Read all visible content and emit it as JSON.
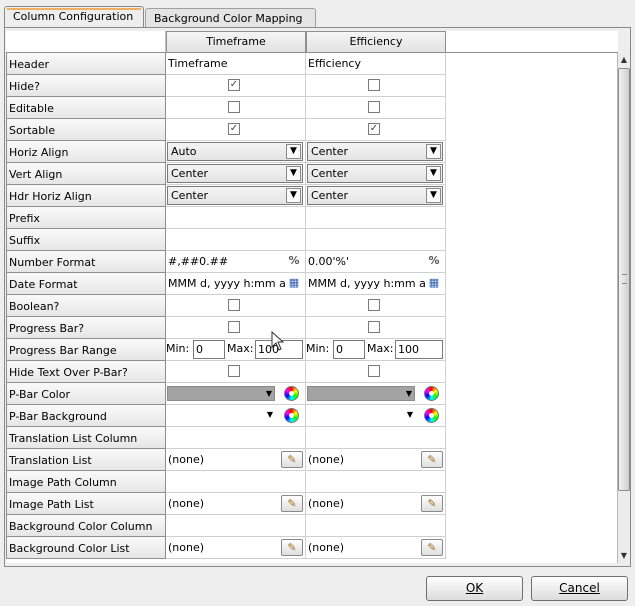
{
  "tabs": [
    {
      "label": "Column Configuration",
      "active": true
    },
    {
      "label": "Background Color Mapping",
      "active": false
    }
  ],
  "columns": [
    "Timeframe",
    "Efficiency"
  ],
  "rows": {
    "header": {
      "label": "Header",
      "values": [
        "Timeframe",
        "Efficiency"
      ]
    },
    "hide": {
      "label": "Hide?",
      "values": [
        true,
        false
      ]
    },
    "editable": {
      "label": "Editable",
      "values": [
        false,
        false
      ]
    },
    "sortable": {
      "label": "Sortable",
      "values": [
        true,
        true
      ]
    },
    "horiz_align": {
      "label": "Horiz Align",
      "values": [
        "Auto",
        "Center"
      ]
    },
    "vert_align": {
      "label": "Vert Align",
      "values": [
        "Center",
        "Center"
      ]
    },
    "hdr_horiz_align": {
      "label": "Hdr Horiz Align",
      "values": [
        "Center",
        "Center"
      ]
    },
    "prefix": {
      "label": "Prefix",
      "values": [
        "",
        ""
      ]
    },
    "suffix": {
      "label": "Suffix",
      "values": [
        "",
        ""
      ]
    },
    "number_format": {
      "label": "Number Format",
      "values": [
        "#,##0.##",
        "0.00'%'"
      ]
    },
    "date_format": {
      "label": "Date Format",
      "values": [
        "MMM d, yyyy h:mm a",
        "MMM d, yyyy h:mm a"
      ]
    },
    "boolean": {
      "label": "Boolean?",
      "values": [
        false,
        false
      ]
    },
    "progress_bar": {
      "label": "Progress Bar?",
      "values": [
        false,
        false
      ]
    },
    "progress_bar_range": {
      "label": "Progress Bar Range",
      "min_label": "Min:",
      "max_label": "Max:",
      "values": [
        {
          "min": "0",
          "max": "100"
        },
        {
          "min": "0",
          "max": "100"
        }
      ]
    },
    "hide_text_over_pbar": {
      "label": "Hide Text Over P-Bar?",
      "values": [
        false
      ]
    },
    "pbar_color": {
      "label": "P-Bar Color",
      "color": "#a3a3a3"
    },
    "pbar_background": {
      "label": "P-Bar Background",
      "color": "#ffffff"
    },
    "translation_list_column": {
      "label": "Translation List Column"
    },
    "translation_list": {
      "label": "Translation List",
      "values": [
        "(none)",
        "(none)"
      ]
    },
    "image_path_column": {
      "label": "Image Path Column"
    },
    "image_path_list": {
      "label": "Image Path List",
      "values": [
        "(none)",
        "(none)"
      ]
    },
    "background_color_column": {
      "label": "Background Color Column"
    },
    "background_color_list": {
      "label": "Background Color List",
      "values": [
        "(none)",
        "(none)"
      ]
    }
  },
  "icons": {
    "dropdown": "chevron-down-icon",
    "number_format": "percent-format-icon",
    "date_format": "calendar-format-icon",
    "color_picker": "color-wheel-icon",
    "edit_list": "edit-list-icon"
  },
  "footer": {
    "ok_label": "OK",
    "cancel_label": "Cancel"
  }
}
